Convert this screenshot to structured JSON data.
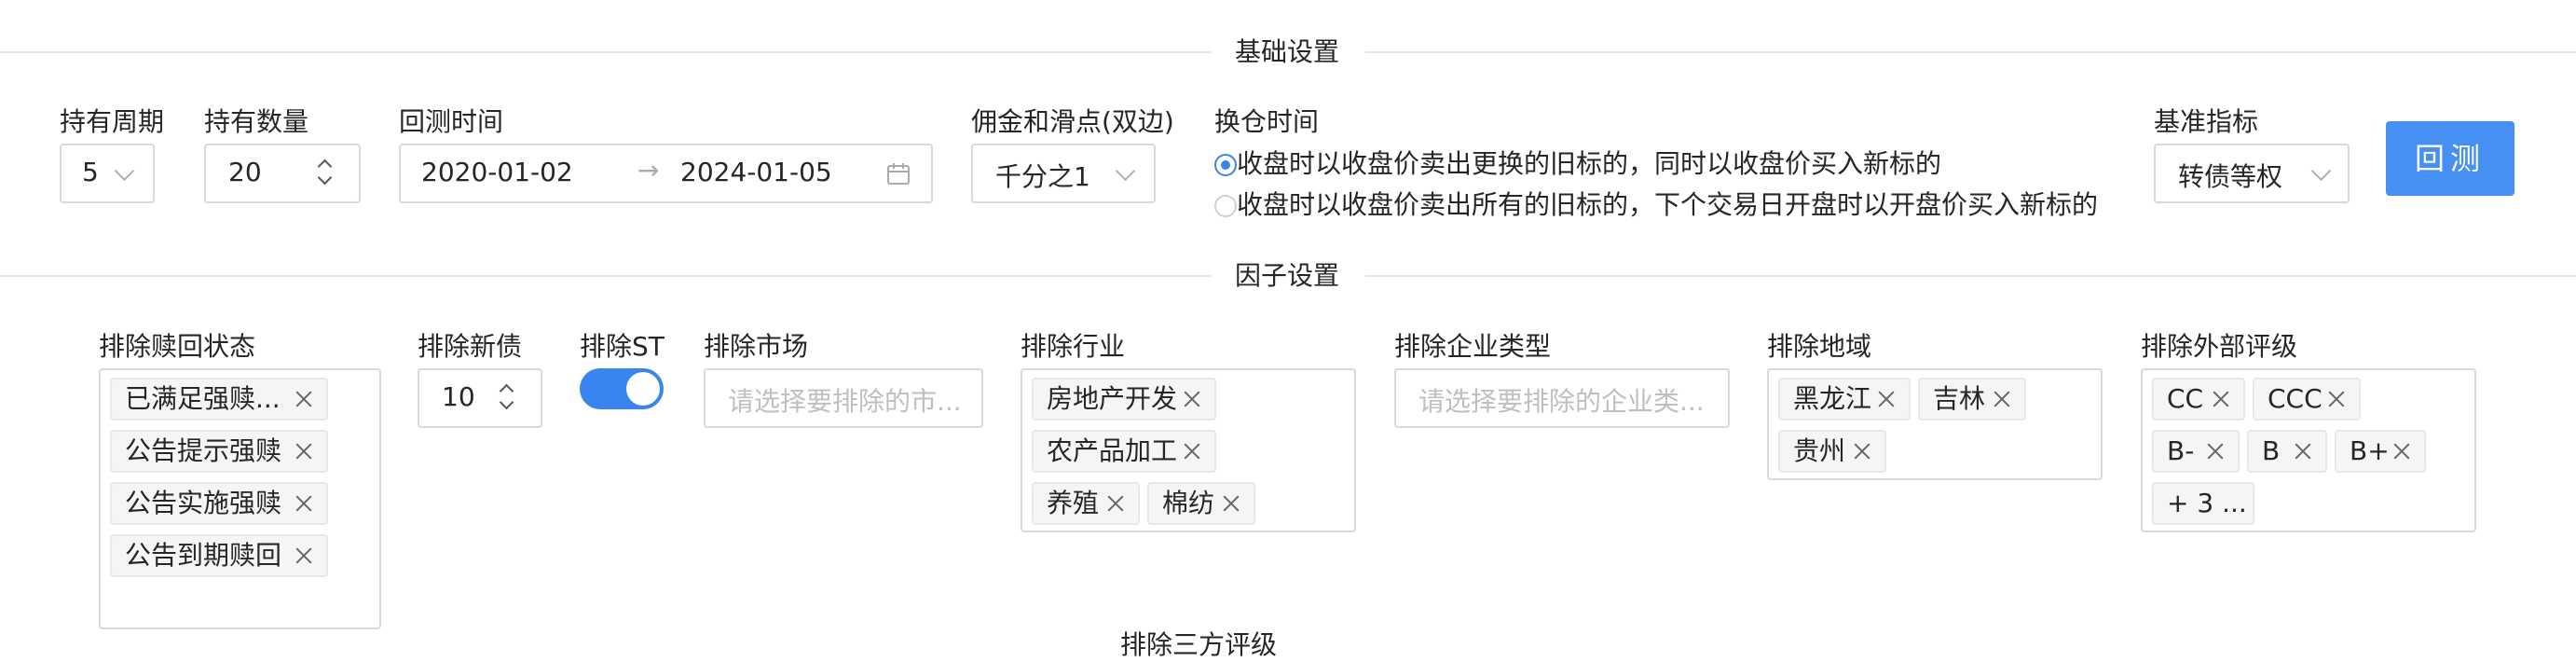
{
  "sections": {
    "basic": "基础设置",
    "factor": "因子设置",
    "third_party_partial": "排除三方评级"
  },
  "basic": {
    "holding_period": {
      "label": "持有周期",
      "value": "5"
    },
    "holding_count": {
      "label": "持有数量",
      "value": "20"
    },
    "backtest_time": {
      "label": "回测时间",
      "start": "2020-01-02",
      "arrow": "→",
      "end": "2024-01-05"
    },
    "commission": {
      "label": "佣金和滑点(双边)",
      "value": "千分之1"
    },
    "rebalance": {
      "label": "换仓时间",
      "options": [
        {
          "text": "收盘时以收盘价卖出更换的旧标的，同时以收盘价买入新标的",
          "selected": true
        },
        {
          "text": "收盘时以收盘价卖出所有的旧标的，下个交易日开盘时以开盘价买入新标的",
          "selected": false
        }
      ]
    },
    "benchmark": {
      "label": "基准指标",
      "value": "转债等权"
    },
    "backtest_button": "回测"
  },
  "factor": {
    "redemption": {
      "label": "排除赎回状态",
      "tags": [
        "已满足强赎...",
        "公告提示强赎",
        "公告实施强赎",
        "公告到期赎回"
      ]
    },
    "new_bonds": {
      "label": "排除新债",
      "value": "10"
    },
    "st": {
      "label": "排除ST",
      "on": true
    },
    "market": {
      "label": "排除市场",
      "placeholder": "请选择要排除的市..."
    },
    "industry": {
      "label": "排除行业",
      "tags": [
        "房地产开发",
        "农产品加工",
        "养殖",
        "棉纺"
      ]
    },
    "company_type": {
      "label": "排除企业类型",
      "placeholder": "请选择要排除的企业类..."
    },
    "region": {
      "label": "排除地域",
      "tags": [
        "黑龙江",
        "吉林",
        "贵州"
      ]
    },
    "rating": {
      "label": "排除外部评级",
      "tags": [
        "CC",
        "CCC",
        "B-",
        "B",
        "B+"
      ],
      "more": "+ 3 ..."
    }
  },
  "colors": {
    "primary": "#3a84f0",
    "button": "#4590f2",
    "border": "#d9d9d9",
    "tag_bg": "#f5f5f5"
  }
}
